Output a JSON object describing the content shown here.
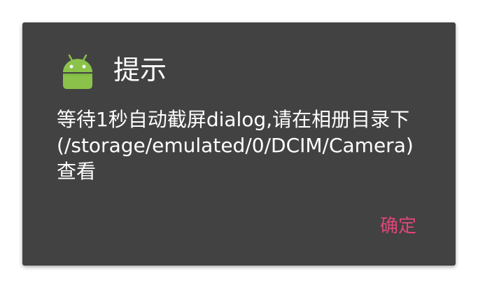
{
  "dialog": {
    "title": "提示",
    "message": "等待1秒自动截屏dialog,请在相册目录下(/storage/emulated/0/DCIM/Camera)查看",
    "ok_label": "确定",
    "icon": "android-robot-icon"
  },
  "colors": {
    "dialog_background": "#424242",
    "page_background": "#ffffff",
    "text": "#ffffff",
    "accent": "#e0457b",
    "android_green": "#8bc34a"
  }
}
